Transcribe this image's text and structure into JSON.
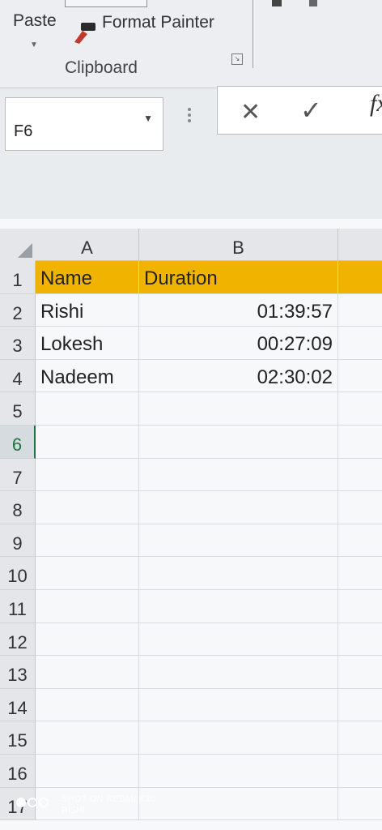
{
  "ribbon": {
    "paste_label": "Paste",
    "format_painter_label": "Format Painter",
    "clipboard_group_label": "Clipboard",
    "launcher_icon": "dialog-launcher-icon"
  },
  "formula_bar": {
    "name_box_value": "F6",
    "cancel_icon": "✕",
    "enter_icon": "✓",
    "fx_icon": "fx"
  },
  "columns": [
    "A",
    "B"
  ],
  "rows": [
    "1",
    "2",
    "3",
    "4",
    "5",
    "6",
    "7",
    "8",
    "9",
    "10",
    "11",
    "12",
    "13",
    "14",
    "15",
    "16",
    "17"
  ],
  "cells": {
    "r1": {
      "a": "Name",
      "b": "Duration"
    },
    "r2": {
      "a": "Rishi",
      "b": "01:39:57"
    },
    "r3": {
      "a": "Lokesh",
      "b": "00:27:09"
    },
    "r4": {
      "a": "Nadeem",
      "b": "02:30:02"
    }
  },
  "watermark": {
    "line1": "SHOT ON REDMI K20",
    "line2": "RISHI"
  },
  "colors": {
    "header_fill": "#f0b400",
    "active_row_accent": "#217346"
  }
}
